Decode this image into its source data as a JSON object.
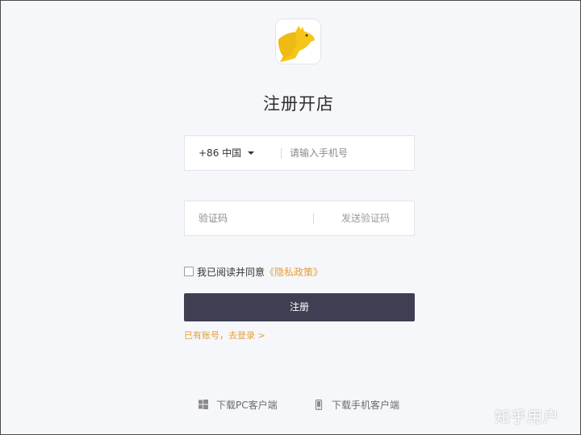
{
  "brand": {
    "logo_icon": "kangaroo-logo-icon",
    "logo_color": "#f5c518"
  },
  "title": "注册开店",
  "phone": {
    "country_code": "+86 中国",
    "placeholder": "请输入手机号",
    "value": ""
  },
  "verification": {
    "placeholder": "验证码",
    "value": "",
    "send_label": "发送验证码"
  },
  "agreement": {
    "checked": false,
    "text": "我已阅读并同意",
    "link_label": "《隐私政策》"
  },
  "submit_label": "注册",
  "login_link": "已有账号，去登录 >",
  "downloads": {
    "pc_label": "下载PC客户端",
    "mobile_label": "下载手机客户端"
  },
  "watermark": "知乎用户",
  "colors": {
    "accent": "#e2a03a",
    "button": "#3e3f53",
    "background": "#f6f7fb"
  }
}
